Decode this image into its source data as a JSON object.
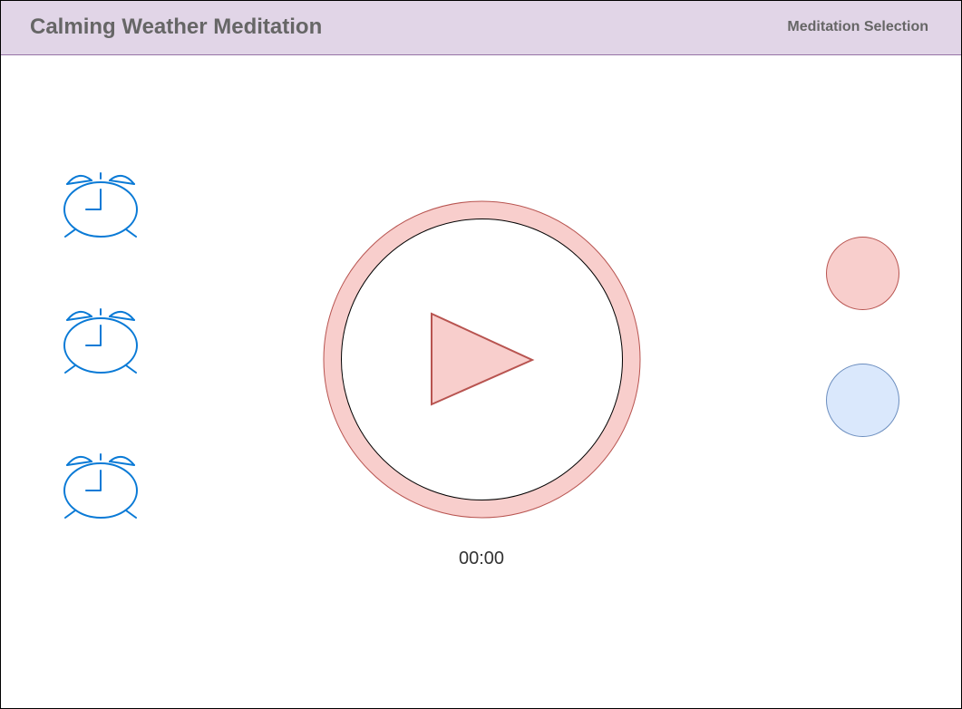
{
  "header": {
    "title": "Calming Weather Meditation",
    "nav_link": "Meditation Selection"
  },
  "alarms": [
    {
      "icon": "alarm-clock-icon"
    },
    {
      "icon": "alarm-clock-icon"
    },
    {
      "icon": "alarm-clock-icon"
    }
  ],
  "player": {
    "play_icon": "play-icon",
    "timer": "00:00"
  },
  "colors": {
    "header_bg": "#e1d5e7",
    "header_border": "#9673a6",
    "title_text": "#666666",
    "alarm_stroke": "#0a7ad6",
    "play_fill": "#f8cecc",
    "play_stroke": "#b85450",
    "option_red_fill": "#f8cecc",
    "option_red_stroke": "#b85450",
    "option_blue_fill": "#dae8fc",
    "option_blue_stroke": "#6c8ebf"
  }
}
